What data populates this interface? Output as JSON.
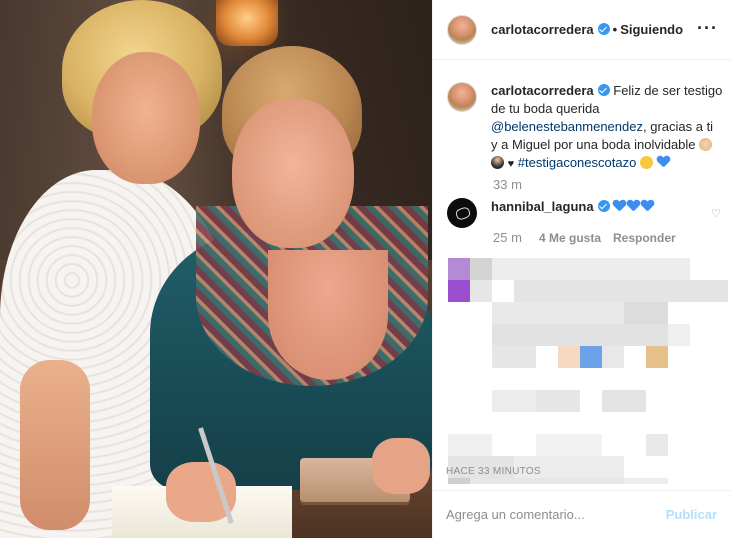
{
  "post": {
    "username": "carlotacorredera",
    "follow_status": "Siguiendo",
    "more_icon": "more-horizontal-icon"
  },
  "caption": {
    "username": "carlotacorredera",
    "text_1": "Feliz de ser testigo de tu boda querida",
    "mention": "@belenestebanmenendez",
    "text_2": ", gracias a ti y a Miguel por una boda inolvidable",
    "hashtag": "#testigaconescotazo",
    "time": "33 m"
  },
  "comment": {
    "username": "hannibal_laguna",
    "time": "25 m",
    "likes": "4 Me gusta",
    "reply": "Responder"
  },
  "blurred_stamp": "HACE 33 MINUTOS",
  "footer": {
    "placeholder": "Agrega un comentario...",
    "publish_label": "Publicar"
  },
  "colors": {
    "verified": "#3897f0",
    "link": "#00376b",
    "publish_disabled": "#b2dffc",
    "muted": "#8e8e8e"
  }
}
